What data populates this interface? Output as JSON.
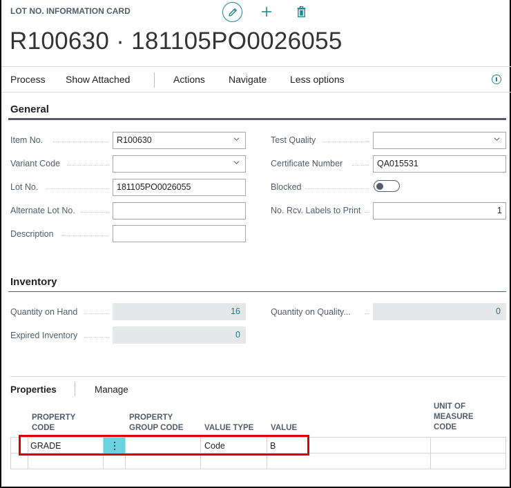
{
  "header": {
    "caption": "LOT NO. INFORMATION CARD",
    "title": "R100630 · 181105PO0026055",
    "icons": [
      "edit-icon",
      "new-icon",
      "delete-icon"
    ]
  },
  "action_bar": {
    "items": [
      "Process",
      "Show Attached",
      "Actions",
      "Navigate",
      "Less options"
    ],
    "info_icon": "info-icon"
  },
  "general": {
    "title": "General",
    "left_fields": [
      {
        "label": "Item No.",
        "value": "R100630",
        "type": "dropdown"
      },
      {
        "label": "Variant Code",
        "value": "",
        "type": "dropdown"
      },
      {
        "label": "Lot No.",
        "value": "181105PO0026055",
        "type": "text"
      },
      {
        "label": "Alternate Lot No.",
        "value": "",
        "type": "text"
      },
      {
        "label": "Description",
        "value": "",
        "type": "text"
      }
    ],
    "right_fields": [
      {
        "label": "Test Quality",
        "value": "",
        "type": "dropdown"
      },
      {
        "label": "Certificate Number",
        "value": "QA015531",
        "type": "text"
      },
      {
        "label": "Blocked",
        "value": "off",
        "type": "toggle"
      },
      {
        "label": "No. Rcv. Labels to Print",
        "value": "1",
        "type": "number"
      }
    ]
  },
  "inventory": {
    "title": "Inventory",
    "fields": [
      {
        "label": "Quantity on Hand",
        "value": "16"
      },
      {
        "label": "Expired Inventory",
        "value": "0"
      },
      {
        "label": "Quantity on Quality...",
        "value": "0"
      }
    ]
  },
  "properties": {
    "tabs": [
      "Properties",
      "Manage"
    ],
    "columns": {
      "property_code": [
        "PROPERTY",
        "CODE"
      ],
      "property_group_code": [
        "PROPERTY",
        "GROUP CODE"
      ],
      "value_type": [
        "VALUE TYPE"
      ],
      "value": [
        "VALUE"
      ],
      "unit_of_measure_code": [
        "UNIT OF",
        "MEASURE",
        "CODE"
      ]
    },
    "rows": [
      {
        "property_code": "GRADE",
        "property_group_code": "",
        "value_type": "Code",
        "value": "B",
        "unit_of_measure_code": ""
      },
      {
        "property_code": "",
        "property_group_code": "",
        "value_type": "",
        "value": "",
        "unit_of_measure_code": ""
      }
    ]
  },
  "colors": {
    "accent": "#1c8a92",
    "row_menu": "#69d3de",
    "highlight": "#e00000",
    "label": "#505c6d"
  }
}
